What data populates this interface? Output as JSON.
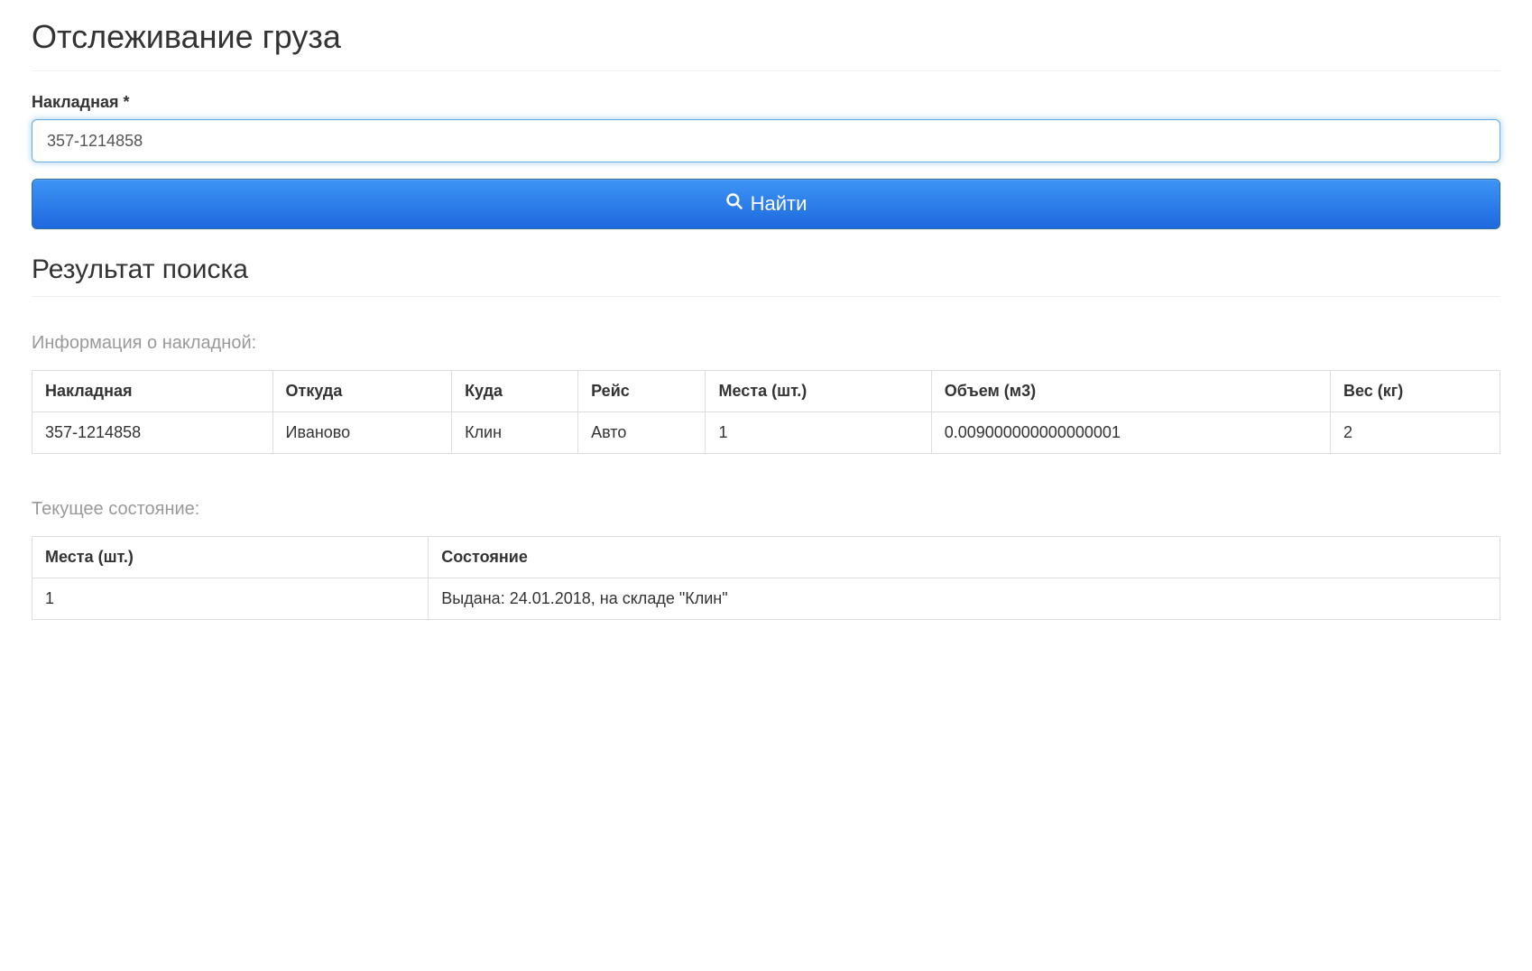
{
  "page": {
    "title": "Отслеживание груза"
  },
  "form": {
    "label": "Накладная *",
    "value": "357-1214858",
    "button": "Найти"
  },
  "results": {
    "title": "Результат поиска",
    "info_section": {
      "title": "Информация о накладной:",
      "headers": {
        "waybill": "Накладная",
        "from": "Откуда",
        "to": "Куда",
        "trip": "Рейс",
        "places": "Места (шт.)",
        "volume": "Объем (м3)",
        "weight": "Вес (кг)"
      },
      "row": {
        "waybill": "357-1214858",
        "from": "Иваново",
        "to": "Клин",
        "trip": "Авто",
        "places": "1",
        "volume": "0.009000000000000001",
        "weight": "2"
      }
    },
    "status_section": {
      "title": "Текущее состояние:",
      "headers": {
        "places": "Места (шт.)",
        "status": "Состояние"
      },
      "row": {
        "places": "1",
        "status": "Выдана: 24.01.2018, на складе \"Клин\""
      }
    }
  }
}
